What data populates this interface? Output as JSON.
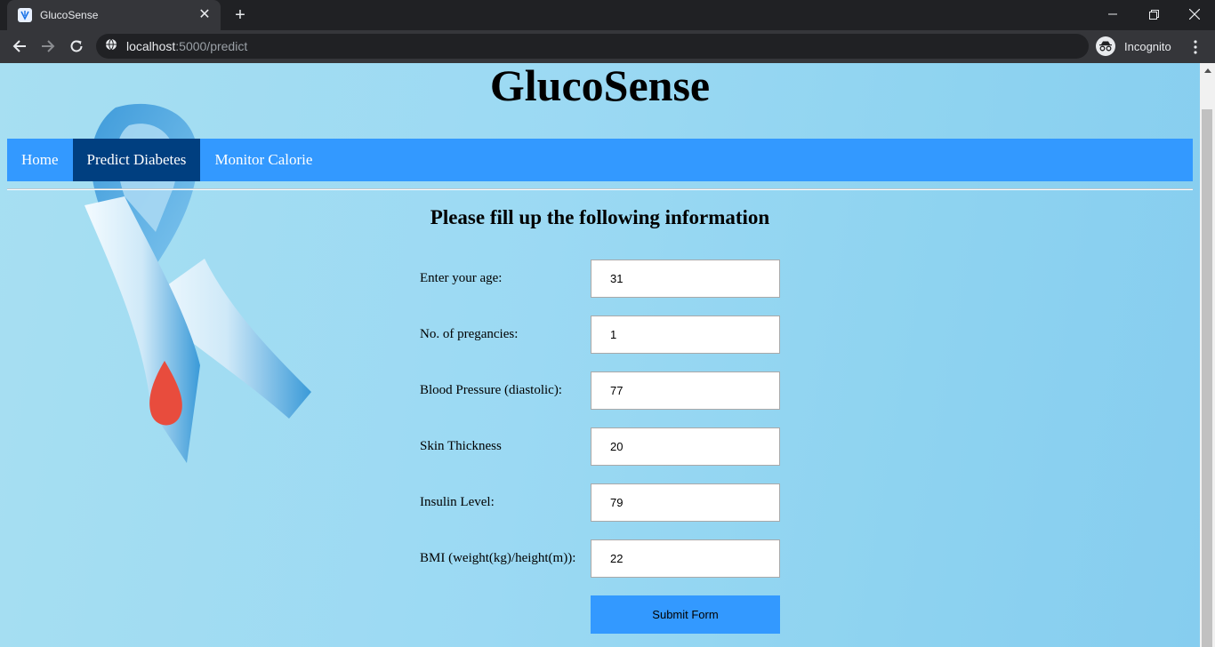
{
  "browser": {
    "tab_title": "GlucoSense",
    "url_host": "localhost",
    "url_path": ":5000/predict",
    "incognito_label": "Incognito"
  },
  "page": {
    "site_title": "GlucoSense",
    "nav": [
      {
        "label": "Home",
        "active": false
      },
      {
        "label": "Predict Diabetes",
        "active": true
      },
      {
        "label": "Monitor Calorie",
        "active": false
      }
    ],
    "form_heading": "Please fill up the following information",
    "fields": [
      {
        "label": "Enter your age:",
        "value": "31"
      },
      {
        "label": "No. of pregancies:",
        "value": "1"
      },
      {
        "label": "Blood Pressure (diastolic):",
        "value": "77"
      },
      {
        "label": "Skin Thickness",
        "value": "20"
      },
      {
        "label": "Insulin Level:",
        "value": "79"
      },
      {
        "label": "BMI (weight(kg)/height(m)):",
        "value": "22"
      }
    ],
    "submit_label": "Submit Form"
  },
  "colors": {
    "nav_bg": "#3399ff",
    "nav_active_bg": "#003f80",
    "submit_bg": "#3399ff",
    "page_bg": "#9bd9f3"
  }
}
